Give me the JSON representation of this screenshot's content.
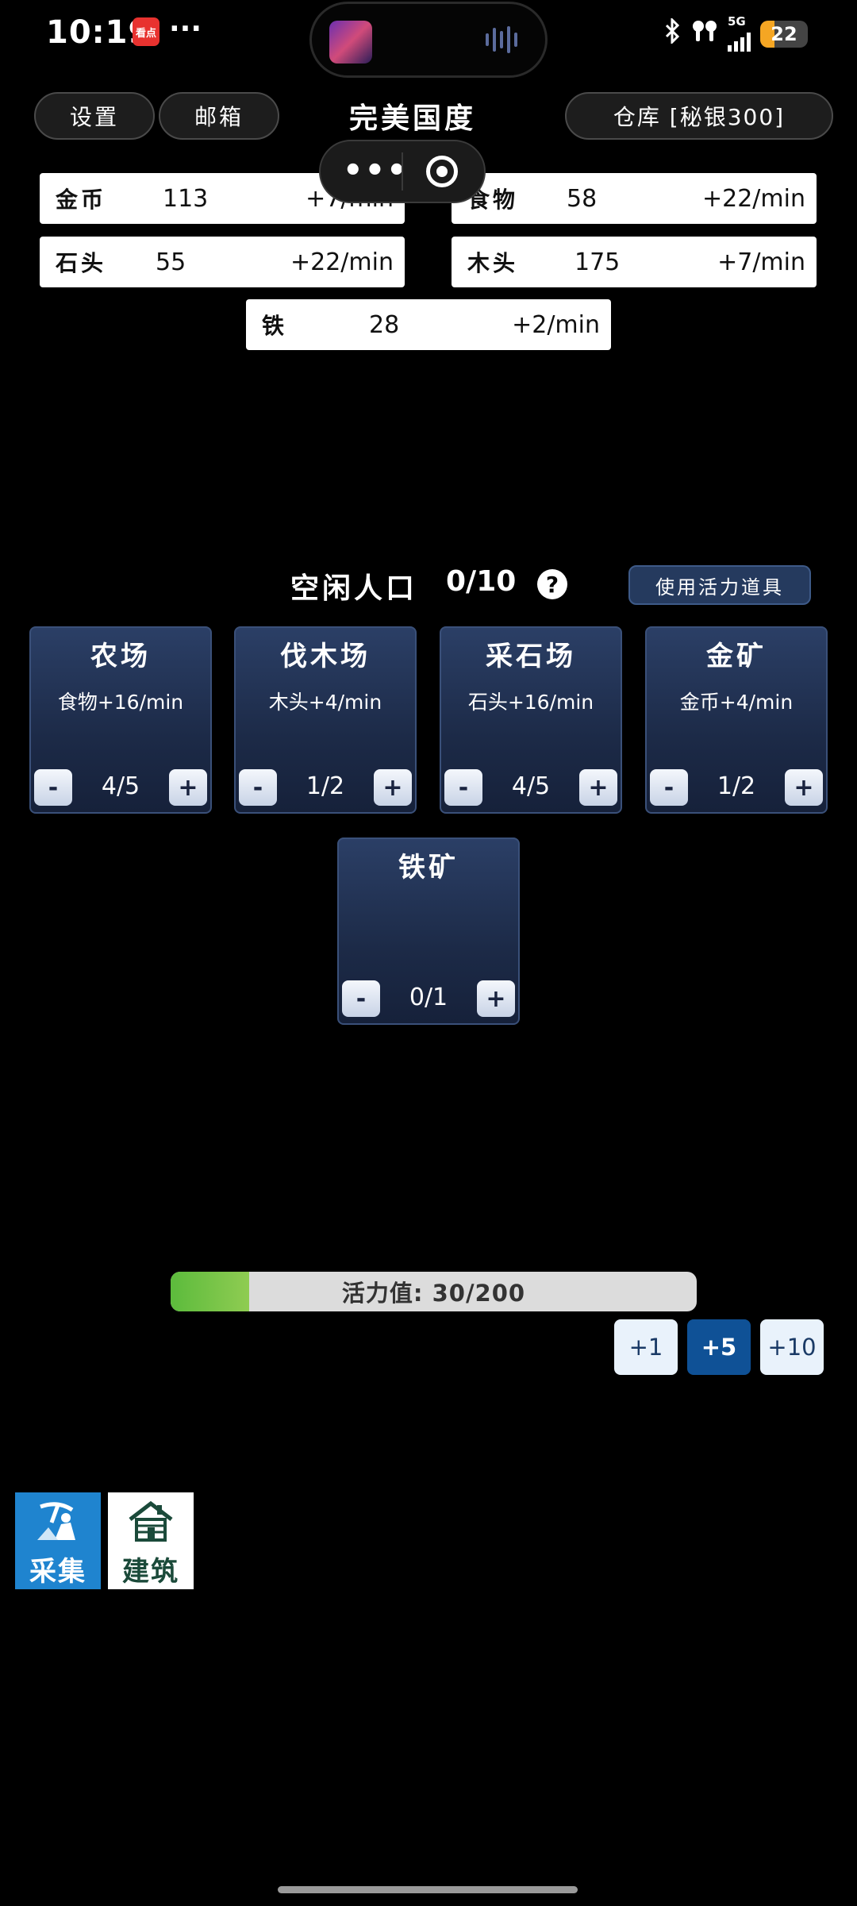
{
  "status_bar": {
    "time": "10:19",
    "app_badge": "看点",
    "more": "···",
    "network": "5G",
    "battery": "22"
  },
  "header": {
    "settings_label": "设置",
    "mailbox_label": "邮箱",
    "title": "完美国度",
    "warehouse_label": "仓库 [秘银300]"
  },
  "capsule": {
    "dots": "•••"
  },
  "resources": [
    {
      "name": "金币",
      "value": "113",
      "rate": "+7/min"
    },
    {
      "name": "食物",
      "value": "58",
      "rate": "+22/min"
    },
    {
      "name": "石头",
      "value": "55",
      "rate": "+22/min"
    },
    {
      "name": "木头",
      "value": "175",
      "rate": "+7/min"
    },
    {
      "name": "铁",
      "value": "28",
      "rate": "+2/min"
    }
  ],
  "population": {
    "label": "空闲人口",
    "value": "0/10",
    "help": "?",
    "use_item_label": "使用活力道具"
  },
  "buildings": [
    {
      "name": "农场",
      "production": "食物+16/min",
      "count": "4/5"
    },
    {
      "name": "伐木场",
      "production": "木头+4/min",
      "count": "1/2"
    },
    {
      "name": "采石场",
      "production": "石头+16/min",
      "count": "4/5"
    },
    {
      "name": "金矿",
      "production": "金币+4/min",
      "count": "1/2"
    },
    {
      "name": "铁矿",
      "production": "",
      "count": "0/1"
    }
  ],
  "controls": {
    "minus": "-",
    "plus": "+"
  },
  "energy": {
    "label": "活力值:  30/200",
    "current": 30,
    "max": 200,
    "fill_color": "#6cc043"
  },
  "steps": {
    "one": "+1",
    "five": "+5",
    "ten": "+10",
    "active": "+5"
  },
  "nav": {
    "gather_label": "采集",
    "build_label": "建筑",
    "gather_icon": "gather-icon",
    "build_icon": "house-icon"
  }
}
